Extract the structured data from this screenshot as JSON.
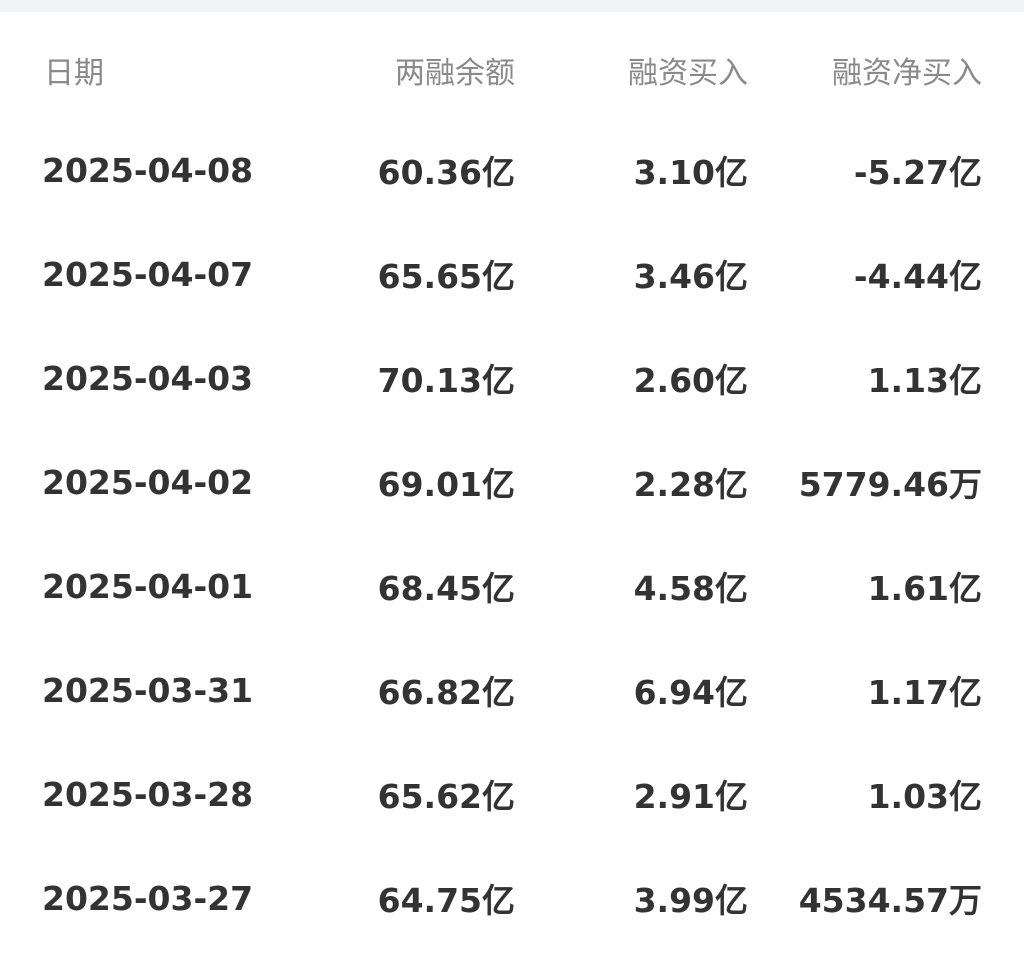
{
  "table": {
    "headers": {
      "date": "日期",
      "balance": "两融余额",
      "financing_buy": "融资买入",
      "financing_net_buy": "融资净买入"
    },
    "rows": [
      {
        "date": "2025-04-08",
        "balance": "60.36亿",
        "financing_buy": "3.10亿",
        "financing_net_buy": "-5.27亿"
      },
      {
        "date": "2025-04-07",
        "balance": "65.65亿",
        "financing_buy": "3.46亿",
        "financing_net_buy": "-4.44亿"
      },
      {
        "date": "2025-04-03",
        "balance": "70.13亿",
        "financing_buy": "2.60亿",
        "financing_net_buy": "1.13亿"
      },
      {
        "date": "2025-04-02",
        "balance": "69.01亿",
        "financing_buy": "2.28亿",
        "financing_net_buy": "5779.46万"
      },
      {
        "date": "2025-04-01",
        "balance": "68.45亿",
        "financing_buy": "4.58亿",
        "financing_net_buy": "1.61亿"
      },
      {
        "date": "2025-03-31",
        "balance": "66.82亿",
        "financing_buy": "6.94亿",
        "financing_net_buy": "1.17亿"
      },
      {
        "date": "2025-03-28",
        "balance": "65.62亿",
        "financing_buy": "2.91亿",
        "financing_net_buy": "1.03亿"
      },
      {
        "date": "2025-03-27",
        "balance": "64.75亿",
        "financing_buy": "3.99亿",
        "financing_net_buy": "4534.57万"
      }
    ]
  }
}
